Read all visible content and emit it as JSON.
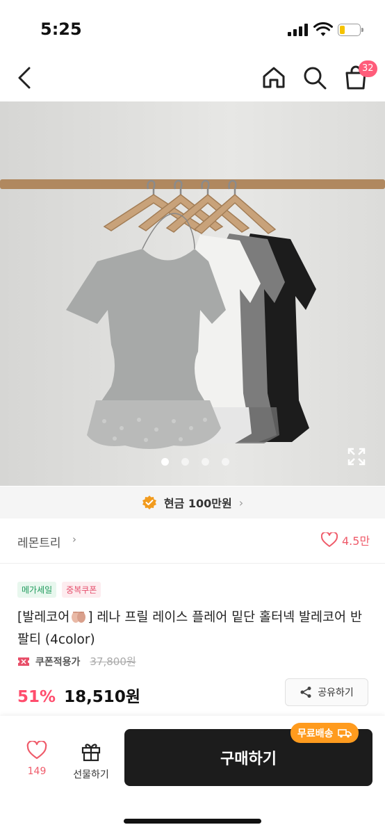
{
  "status_bar": {
    "time": "5:25",
    "battery_level": 0.2,
    "battery_color": "#f5c300"
  },
  "nav": {
    "back_icon": "chevron-left-icon",
    "home_icon": "home-icon",
    "search_icon": "search-icon",
    "cart_icon": "shopping-bag-icon",
    "cart_count": "32",
    "badge_color": "#ff5c7a"
  },
  "gallery": {
    "image_count": 4,
    "active_index": 0,
    "expand_icon": "expand-icon"
  },
  "cash_banner": {
    "label": "현금 100만원",
    "chevron": "›"
  },
  "store": {
    "name": "레몬트리",
    "chevron": "›",
    "likes": "4.5만"
  },
  "product": {
    "badges": [
      "메가세일",
      "중복쿠폰"
    ],
    "title_prefix": "[발레코어",
    "title_suffix": "] 레나 프릴 레이스 플레어 밑단 홀터넥 발레코어 반팔티 (4color)",
    "coupon_label": "쿠폰적용가",
    "original_price": "37,800원",
    "discount": "51%",
    "price": "18,510원",
    "accent_color": "#ff4d6d"
  },
  "share": {
    "label": "공유하기"
  },
  "bottom_bar": {
    "like_count": "149",
    "gift_label": "선물하기",
    "buy_label": "구매하기",
    "free_shipping": "무료배송"
  }
}
